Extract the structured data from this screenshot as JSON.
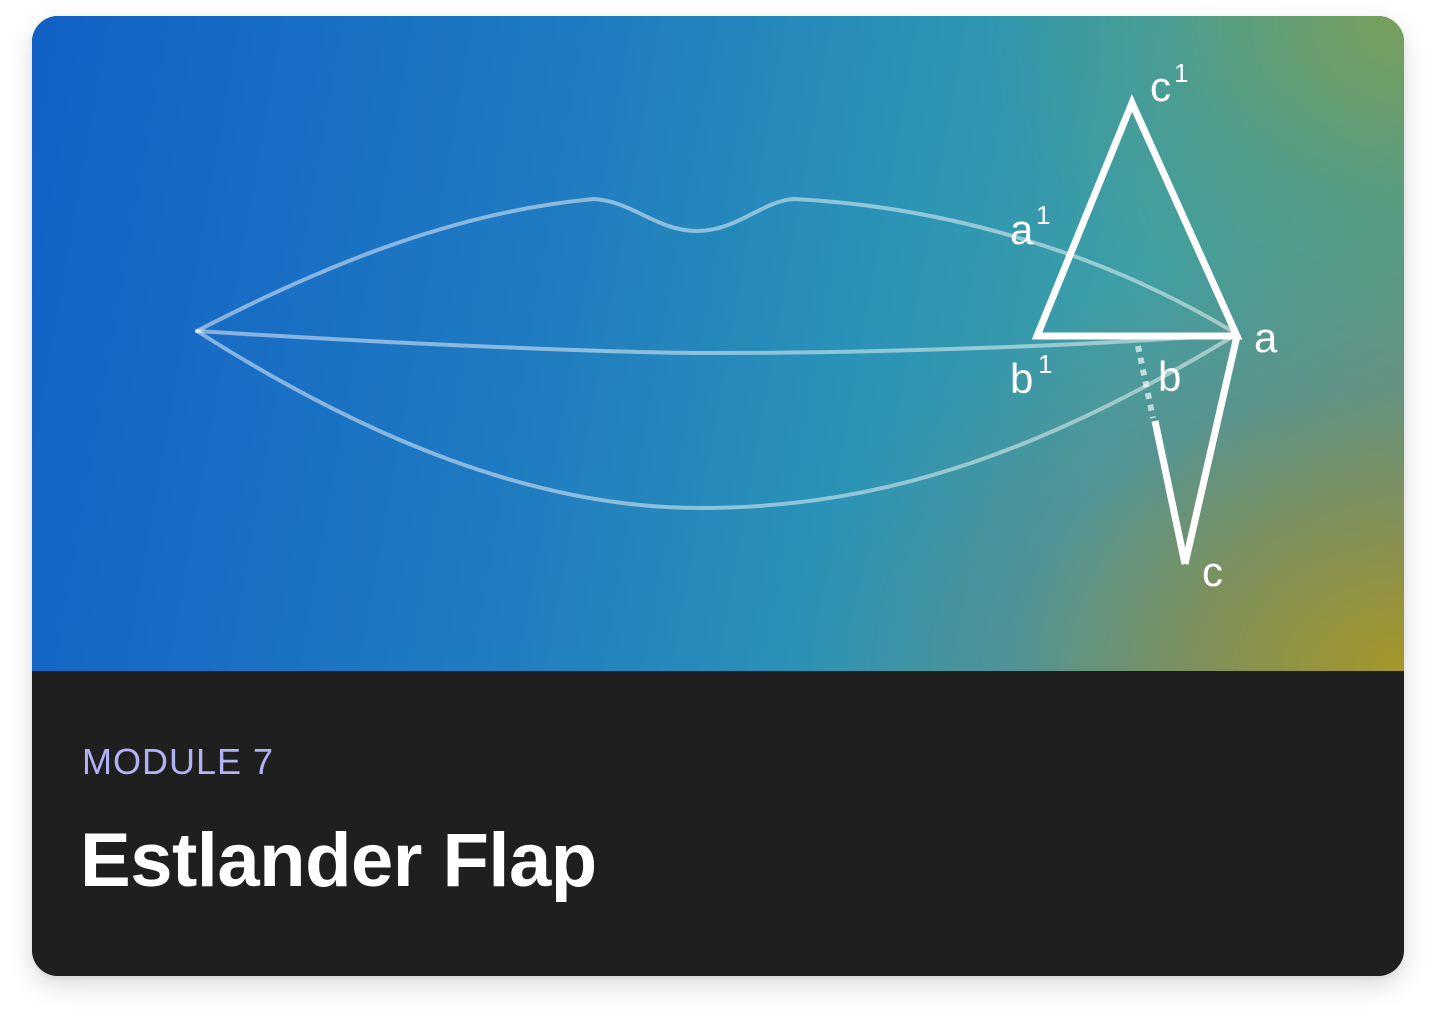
{
  "card": {
    "module_label": "MODULE 7",
    "title": "Estlander Flap"
  },
  "diagram": {
    "labels": {
      "c_prime": "c",
      "c_prime_sup": "1",
      "a_prime": "a",
      "a_prime_sup": "1",
      "a": "a",
      "b_prime": "b",
      "b_prime_sup": "1",
      "b": "b",
      "c": "c"
    }
  },
  "colors": {
    "footer_background": "#1f1f1f",
    "module_label": "#b3b2f4",
    "title": "#ffffff",
    "diagram_lines": "#ffffff"
  }
}
